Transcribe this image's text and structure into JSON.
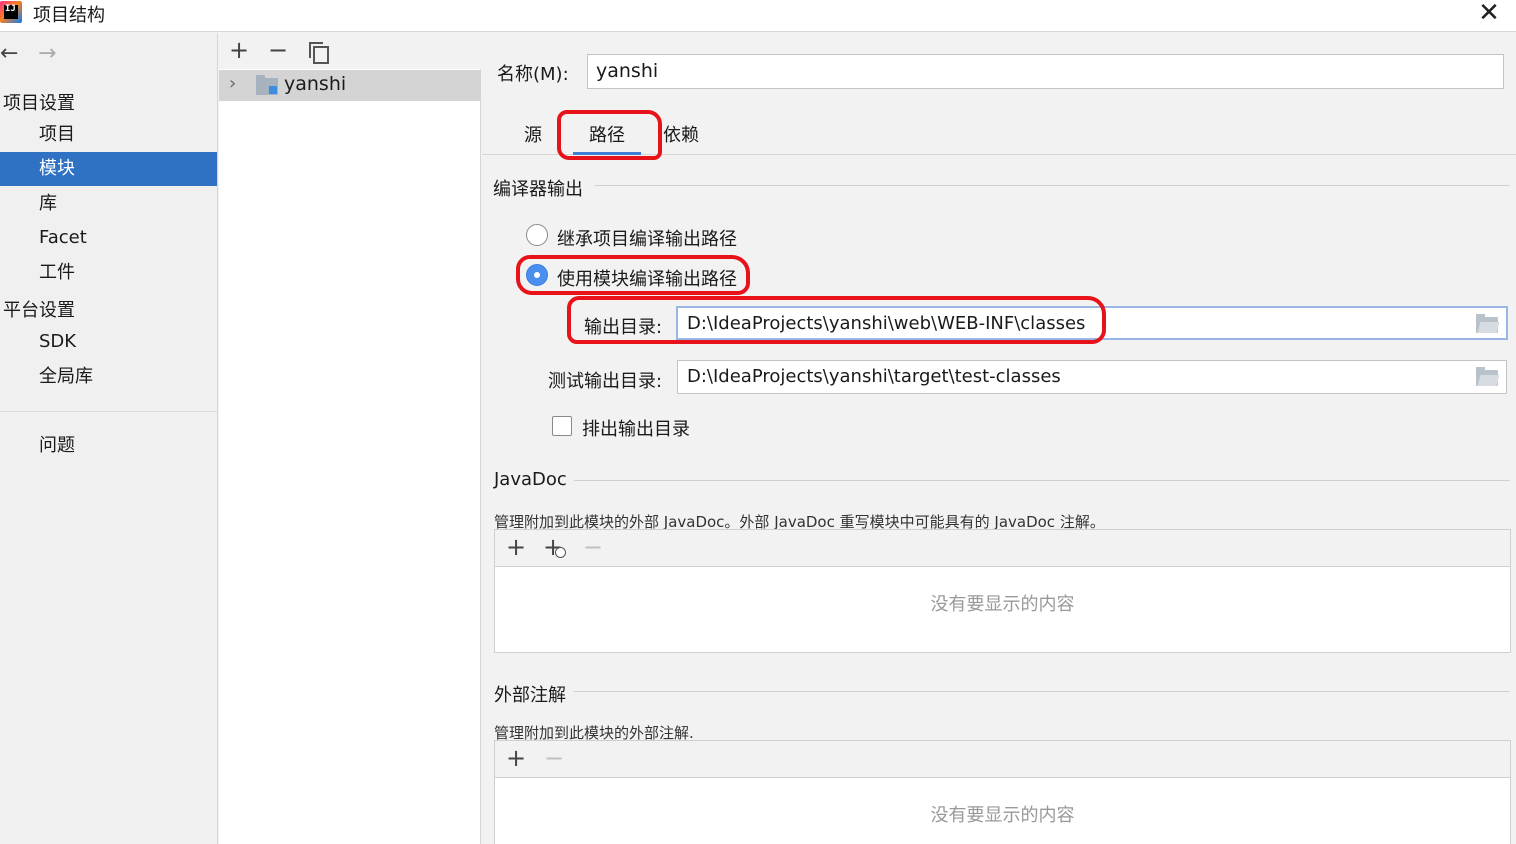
{
  "window": {
    "title": "项目结构",
    "logo_text": "IJ"
  },
  "sidebar": {
    "section_project": "项目设置",
    "project_items": [
      {
        "label": "项目"
      },
      {
        "label": "模块",
        "selected": true
      },
      {
        "label": "库"
      },
      {
        "label": "Facet"
      },
      {
        "label": "工件"
      }
    ],
    "section_platform": "平台设置",
    "platform_items": [
      {
        "label": "SDK"
      },
      {
        "label": "全局库"
      }
    ],
    "problems": "问题"
  },
  "tree": {
    "module_name": "yanshi"
  },
  "main": {
    "name_label": "名称(M):",
    "name_value": "yanshi",
    "tabs": [
      {
        "label": "源"
      },
      {
        "label": "路径",
        "active": true
      },
      {
        "label": "依赖"
      }
    ],
    "compiler": {
      "title": "编译器输出",
      "inherit_label": "继承项目编译输出路径",
      "use_module_label": "使用模块编译输出路径",
      "output_label": "输出目录:",
      "output_value": "D:\\IdeaProjects\\yanshi\\web\\WEB-INF\\classes",
      "test_output_label": "测试输出目录:",
      "test_output_value": "D:\\IdeaProjects\\yanshi\\target\\test-classes",
      "exclude_label": "排出输出目录"
    },
    "javadoc": {
      "title": "JavaDoc",
      "description": "管理附加到此模块的外部 JavaDoc。外部 JavaDoc 重写模块中可能具有的 JavaDoc 注解。",
      "empty": "没有要显示的内容"
    },
    "annotations": {
      "title": "外部注解",
      "description": "管理附加到此模块的外部注解.",
      "empty": "没有要显示的内容"
    }
  },
  "icons": {
    "add": "+",
    "remove": "−",
    "back": "←",
    "forward": "→",
    "chevron": "›",
    "close": "✕"
  },
  "colors": {
    "selection": "#2f72c4",
    "tab_underline": "#3f7fd3",
    "annotation": "#e8131a",
    "radio_checked": "#4a8ff0"
  }
}
